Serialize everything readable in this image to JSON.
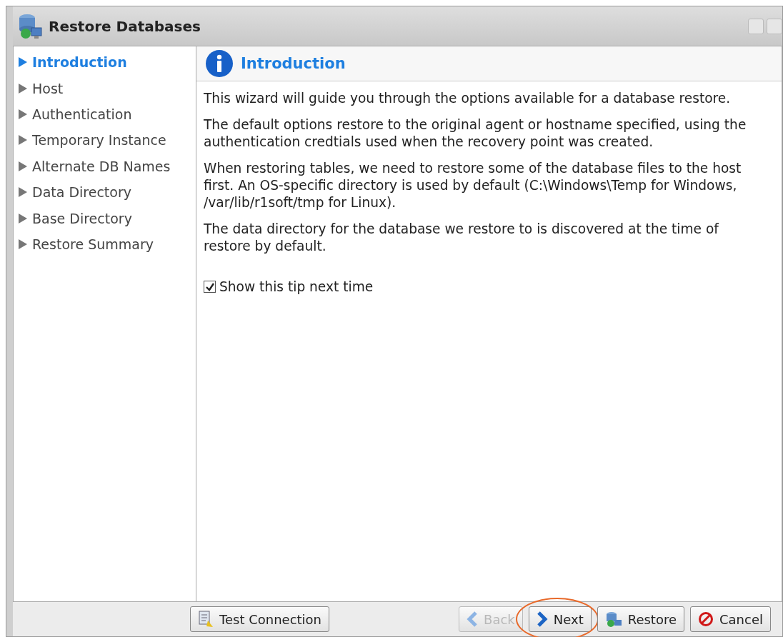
{
  "window": {
    "title": "Restore Databases"
  },
  "sidebar": {
    "items": [
      {
        "label": "Introduction",
        "selected": true
      },
      {
        "label": "Host",
        "selected": false
      },
      {
        "label": "Authentication",
        "selected": false
      },
      {
        "label": "Temporary Instance",
        "selected": false
      },
      {
        "label": "Alternate DB Names",
        "selected": false
      },
      {
        "label": "Data Directory",
        "selected": false
      },
      {
        "label": "Base Directory",
        "selected": false
      },
      {
        "label": "Restore Summary",
        "selected": false
      }
    ]
  },
  "content": {
    "title": "Introduction",
    "paragraphs": [
      "This wizard will guide you through the options available for a database restore.",
      "The default options restore to the original agent or hostname specified, using the authentication credtials used when the recovery point was created.",
      "When restoring tables, we need to restore some of the database files to the host first. An OS-specific directory is used by default (C:\\Windows\\Temp for Windows, /var/lib/r1soft/tmp for Linux).",
      "The data directory for the database we restore to is discovered at the time of restore by default."
    ],
    "checkbox": {
      "label": "Show this tip next time",
      "checked": true
    }
  },
  "buttons": [
    {
      "label": "Test Connection",
      "kind": "test",
      "disabled": false,
      "highlighted": false
    },
    {
      "label": "Back",
      "kind": "back",
      "disabled": true,
      "highlighted": false
    },
    {
      "label": "Next",
      "kind": "next",
      "disabled": false,
      "highlighted": true
    },
    {
      "label": "Restore",
      "kind": "restore",
      "disabled": false,
      "highlighted": false
    },
    {
      "label": "Cancel",
      "kind": "cancel",
      "disabled": false,
      "highlighted": false
    }
  ]
}
